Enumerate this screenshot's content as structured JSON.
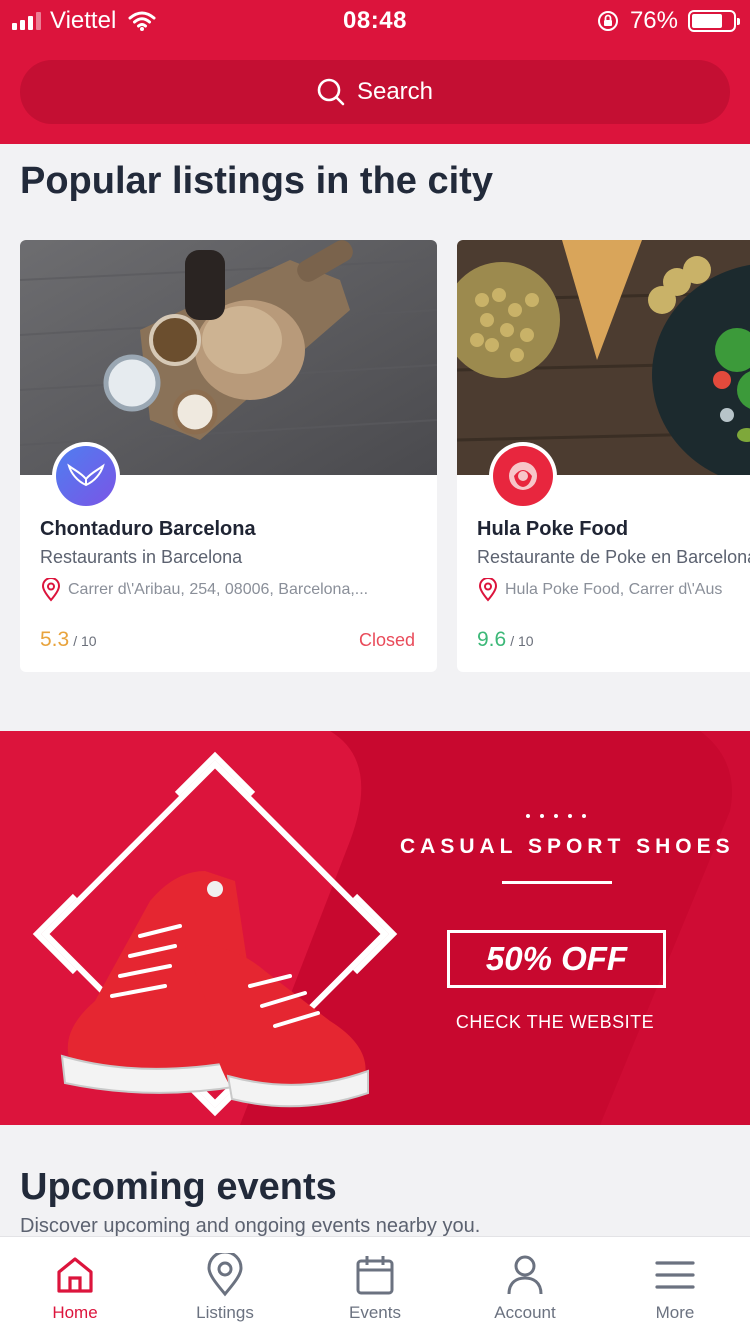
{
  "status_bar": {
    "carrier": "Viettel",
    "time": "08:48",
    "battery": "76%",
    "battery_level": 0.76
  },
  "search": {
    "label": "Search"
  },
  "popular": {
    "title": "Popular listings in the city",
    "cards": [
      {
        "name": "Chontaduro Barcelona",
        "category": "Restaurants in Barcelona",
        "address": "Carrer d\\'Aribau, 254, 08006, Barcelona,...",
        "rating": "5.3",
        "rating_max": "/ 10",
        "status": "Closed",
        "rating_color": "#e8a33c"
      },
      {
        "name": "Hula Poke Food",
        "category": "Restaurante de Poke en Barcelona",
        "address": "Hula Poke Food, Carrer d\\'Aus",
        "rating": "9.6",
        "rating_max": "/ 10",
        "status": "",
        "rating_color": "#3cb878"
      }
    ]
  },
  "banner": {
    "title": "CASUAL  SPORT  SHOES",
    "offer": "50% OFF",
    "cta": "CHECK THE WEBSITE"
  },
  "events": {
    "title": "Upcoming events",
    "subtitle": "Discover upcoming and ongoing events nearby you."
  },
  "tabs": [
    {
      "label": "Home",
      "icon": "home-icon"
    },
    {
      "label": "Listings",
      "icon": "map-pin-icon"
    },
    {
      "label": "Events",
      "icon": "calendar-icon"
    },
    {
      "label": "Account",
      "icon": "user-icon"
    },
    {
      "label": "More",
      "icon": "menu-icon"
    }
  ],
  "colors": {
    "brand": "#dc143c",
    "banner": "#c8082f"
  }
}
